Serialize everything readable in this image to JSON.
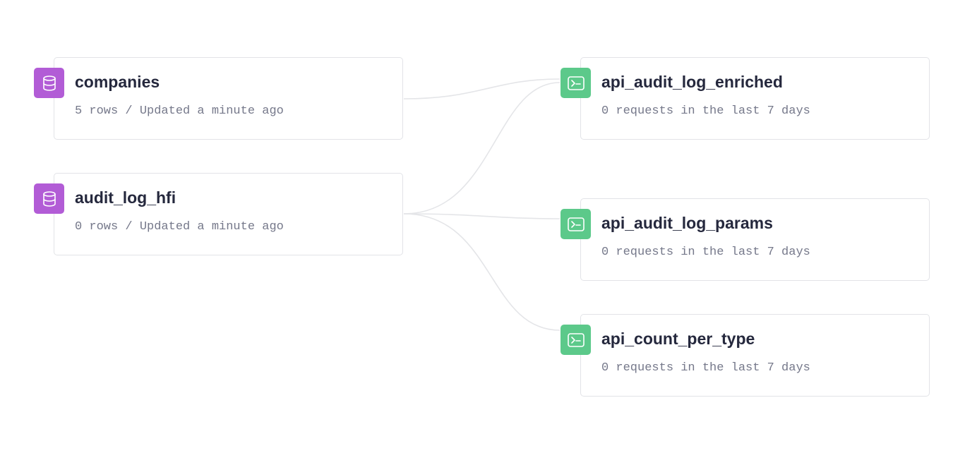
{
  "colors": {
    "datasource_badge": "#b25cd6",
    "endpoint_badge": "#5cc98a",
    "edge": "#e4e5e8",
    "node_border": "#e2e3e7",
    "title_text": "#25283d",
    "subtitle_text": "#75788a"
  },
  "datasources": [
    {
      "name": "companies",
      "meta": "5 rows / Updated a minute ago",
      "icon": "database-icon"
    },
    {
      "name": "audit_log_hfi",
      "meta": "0 rows / Updated a minute ago",
      "icon": "database-icon"
    }
  ],
  "endpoints": [
    {
      "name": "api_audit_log_enriched",
      "meta": "0 requests in the last 7 days",
      "icon": "terminal-icon"
    },
    {
      "name": "api_audit_log_params",
      "meta": "0 requests in the last 7 days",
      "icon": "terminal-icon"
    },
    {
      "name": "api_count_per_type",
      "meta": "0 requests in the last 7 days",
      "icon": "terminal-icon"
    }
  ],
  "edges": [
    {
      "from": "companies",
      "to": "api_audit_log_enriched"
    },
    {
      "from": "audit_log_hfi",
      "to": "api_audit_log_enriched"
    },
    {
      "from": "audit_log_hfi",
      "to": "api_audit_log_params"
    },
    {
      "from": "audit_log_hfi",
      "to": "api_count_per_type"
    }
  ]
}
